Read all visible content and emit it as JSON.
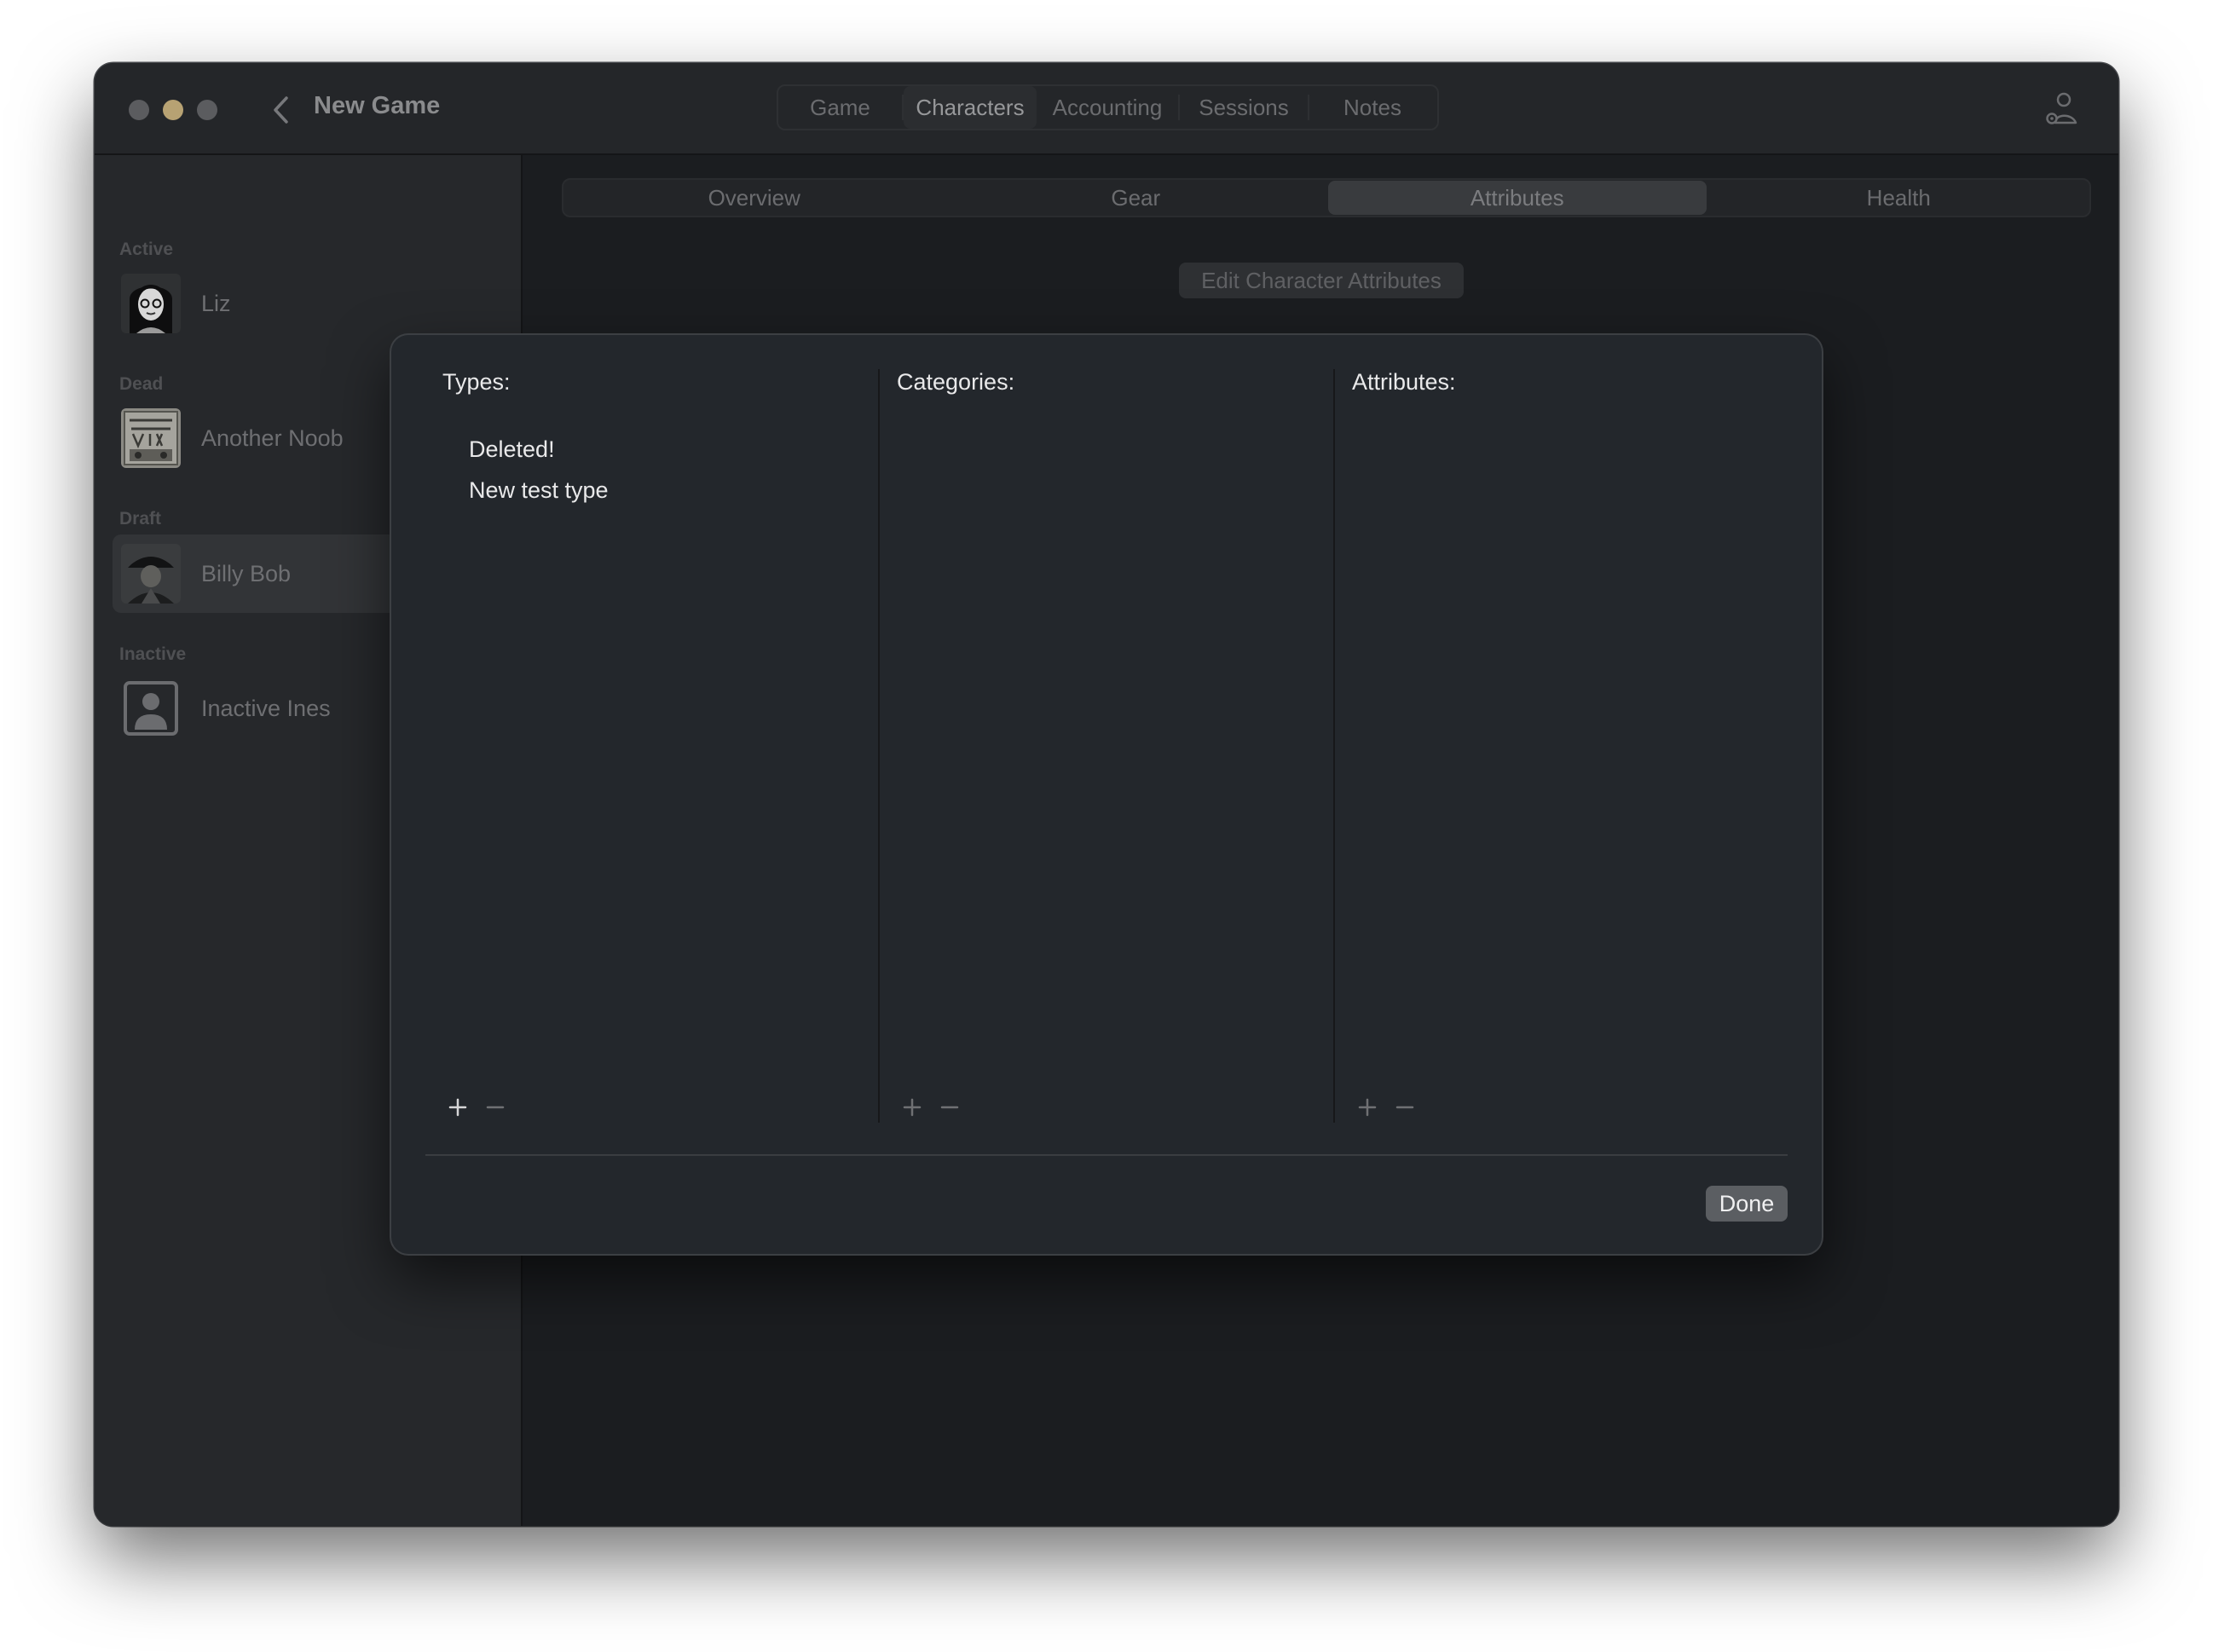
{
  "window": {
    "title": "New Game"
  },
  "top_tabs": [
    {
      "label": "Game"
    },
    {
      "label": "Characters",
      "selected": true
    },
    {
      "label": "Accounting"
    },
    {
      "label": "Sessions"
    },
    {
      "label": "Notes"
    }
  ],
  "sidebar": {
    "sections": [
      {
        "label": "Active",
        "characters": [
          {
            "name": "Liz"
          }
        ]
      },
      {
        "label": "Dead",
        "characters": [
          {
            "name": "Another Noob"
          }
        ]
      },
      {
        "label": "Draft",
        "characters": [
          {
            "name": "Billy Bob",
            "selected": true
          }
        ]
      },
      {
        "label": "Inactive",
        "characters": [
          {
            "name": "Inactive Ines"
          }
        ]
      }
    ]
  },
  "detail_tabs": [
    {
      "label": "Overview"
    },
    {
      "label": "Gear"
    },
    {
      "label": "Attributes",
      "selected": true
    },
    {
      "label": "Health"
    }
  ],
  "edit_button": {
    "label": "Edit Character Attributes"
  },
  "sheet": {
    "types": {
      "title": "Types:",
      "items": [
        "Deleted!",
        "New test type"
      ]
    },
    "categories": {
      "title": "Categories:",
      "items": []
    },
    "attributes": {
      "title": "Attributes:",
      "items": []
    },
    "done_label": "Done"
  },
  "icons": {
    "back": "chevron-left-icon",
    "user": "person-gear-icon",
    "add": "plus-icon",
    "remove": "minus-icon"
  }
}
